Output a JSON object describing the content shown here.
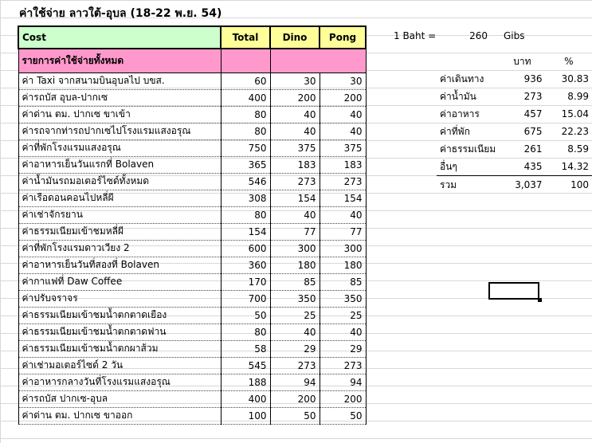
{
  "title": "ค่าใช้จ่าย ลาวใต้-อุบล (18-22 พ.ย. 54)",
  "header": {
    "cost": "Cost",
    "total": "Total",
    "dino": "Dino",
    "pong": "Pong"
  },
  "category": "รายการค่าใช้จ่ายทั้งหมด",
  "rows": [
    {
      "label": "ค่า Taxi จากสนามบินอุบลไป บขส.",
      "total": "60",
      "dino": "30",
      "pong": "30"
    },
    {
      "label": "ค่ารถบัส อุบล-ปากเซ",
      "total": "400",
      "dino": "200",
      "pong": "200"
    },
    {
      "label": "ค่าด่าน ตม. ปากเซ ขาเข้า",
      "total": "80",
      "dino": "40",
      "pong": "40"
    },
    {
      "label": "ค่ารถจากท่ารถปากเซไปโรงแรมแสงอรุณ",
      "total": "80",
      "dino": "40",
      "pong": "40"
    },
    {
      "label": "ค่าที่พักโรงแรมแสงอรุณ",
      "total": "750",
      "dino": "375",
      "pong": "375"
    },
    {
      "label": "ค่าอาหารเย็นวันแรกที่ Bolaven",
      "total": "365",
      "dino": "183",
      "pong": "183"
    },
    {
      "label": "ค่าน้ำมันรถมอเตอร์ไซด์ทั้งหมด",
      "total": "546",
      "dino": "273",
      "pong": "273"
    },
    {
      "label": "ค่าเรือดอนคอนไปหลี่ผี",
      "total": "308",
      "dino": "154",
      "pong": "154"
    },
    {
      "label": "ค่าเช่าจักรยาน",
      "total": "80",
      "dino": "40",
      "pong": "40"
    },
    {
      "label": "ค่าธรรมเนียมเข้าชมหลี่ผี",
      "total": "154",
      "dino": "77",
      "pong": "77"
    },
    {
      "label": "ค่าที่พักโรงแรมดาวเวียง 2",
      "total": "600",
      "dino": "300",
      "pong": "300"
    },
    {
      "label": "ค่าอาหารเย็นวันที่สองที่ Bolaven",
      "total": "360",
      "dino": "180",
      "pong": "180"
    },
    {
      "label": "ค่ากาแฟที่ Daw Coffee",
      "total": "170",
      "dino": "85",
      "pong": "85"
    },
    {
      "label": "ค่าปรับจราจร",
      "total": "700",
      "dino": "350",
      "pong": "350"
    },
    {
      "label": "ค่าธรรมเนียมเข้าชมน้ำตกตาดเยือง",
      "total": "50",
      "dino": "25",
      "pong": "25"
    },
    {
      "label": "ค่าธรรมเนียมเข้าชมน้ำตกตาดฟาน",
      "total": "80",
      "dino": "40",
      "pong": "40"
    },
    {
      "label": "ค่าธรรมเนียมเข้าชมน้ำตกผาส้วม",
      "total": "58",
      "dino": "29",
      "pong": "29"
    },
    {
      "label": "ค่าเช่ามอเตอร์ไซด์ 2 วัน",
      "total": "545",
      "dino": "273",
      "pong": "273"
    },
    {
      "label": "ค่าอาหารกลางวันที่โรงแรมแสงอรุณ",
      "total": "188",
      "dino": "94",
      "pong": "94"
    },
    {
      "label": "ค่ารถบัส ปากเซ-อุบล",
      "total": "400",
      "dino": "200",
      "pong": "200"
    },
    {
      "label": "ค่าด่าน ตม. ปากเซ ขาออก",
      "total": "100",
      "dino": "50",
      "pong": "50"
    }
  ],
  "exchange": {
    "label": "1 Baht =",
    "value": "260",
    "unit": "Gibs"
  },
  "summary": {
    "col_baht": "บาท",
    "col_pct": "%",
    "items": [
      {
        "label": "ค่าเดินทาง",
        "baht": "936",
        "pct": "30.83"
      },
      {
        "label": "ค่าน้ำมัน",
        "baht": "273",
        "pct": "8.99"
      },
      {
        "label": "ค่าอาหาร",
        "baht": "457",
        "pct": "15.04"
      },
      {
        "label": "ค่าที่พัก",
        "baht": "675",
        "pct": "22.23"
      },
      {
        "label": "ค่าธรรมเนียม",
        "baht": "261",
        "pct": "8.59"
      },
      {
        "label": "อื่นๆ",
        "baht": "435",
        "pct": "14.32"
      }
    ],
    "total": {
      "label": "รวม",
      "baht": "3,037",
      "pct": "100"
    }
  }
}
